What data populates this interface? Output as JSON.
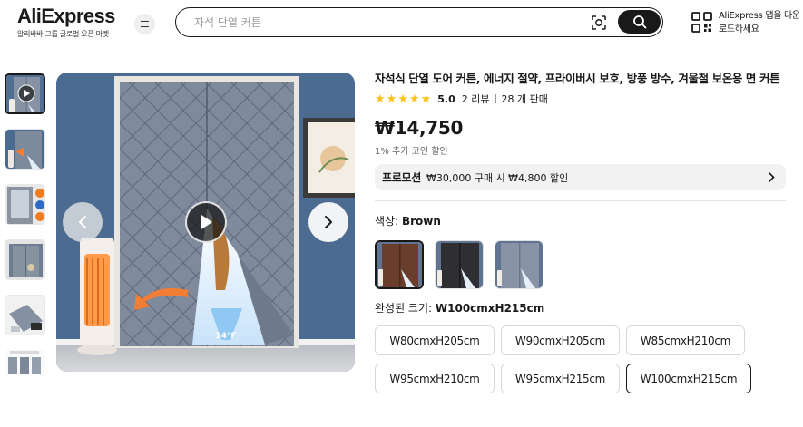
{
  "header": {
    "logo_text": "AliExpress",
    "logo_subtitle": "알리바바 그룹 글로벌 오픈 마켓",
    "search_placeholder": "자석 단열 커튼",
    "app_promo": "AliExpress 앱을 다운로드하세요",
    "icons": {
      "menu": "hamburger-menu-icon",
      "camera": "camera-search-icon",
      "search": "search-icon",
      "qr": "qr-code-icon"
    }
  },
  "product": {
    "title": "자석식 단열 도어 커튼, 에너지 절약, 프라이버시 보호, 방풍 방수, 겨울철 보온용 면 커튼",
    "rating": {
      "stars": 5,
      "score": "5.0",
      "reviews": "2 리뷰",
      "sold": "28 개 판매"
    },
    "price": "₩14,750",
    "coin_discount": "1% 추가 코인 할인",
    "promotion": {
      "label": "프로모션",
      "text": "₩30,000 구매 시 ₩4,800 할인"
    },
    "color": {
      "label": "색상:",
      "value": "Brown",
      "selected_index": 0,
      "swatch_count": 3
    },
    "size": {
      "label": "완성된 크기:",
      "value": "W100cmxH215cm",
      "options": [
        "W80cmxH205cm",
        "W90cmxH205cm",
        "W85cmxH210cm",
        "W95cmxH210cm",
        "W95cmxH215cm",
        "W100cmxH215cm"
      ],
      "selected_index": 5
    }
  },
  "gallery": {
    "thumbnail_count": 6,
    "active_thumbnail": 0,
    "temperature_label": "14°F"
  },
  "colors": {
    "accent": "#191919",
    "star": "#fdc21a",
    "promo_bg": "#f2f2f2",
    "wall": "#4d6c90",
    "curtain": "#7f8c9d"
  }
}
